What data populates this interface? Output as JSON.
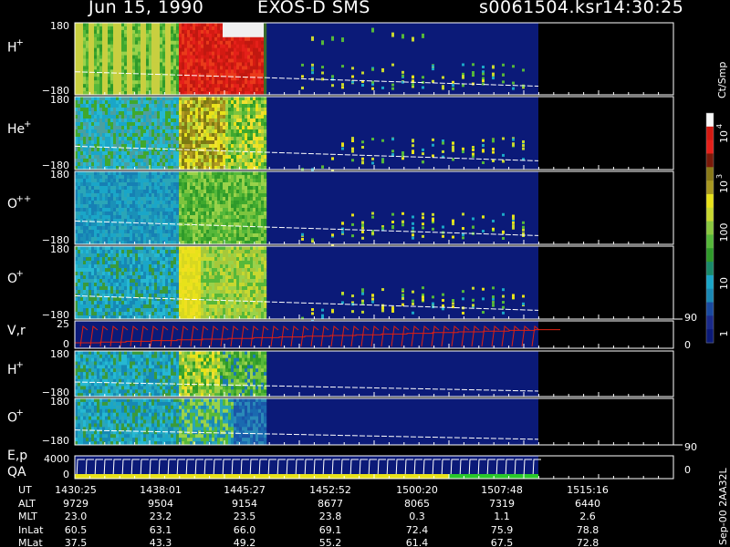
{
  "header": {
    "date": "Jun 15, 1990",
    "instrument": "EXOS-D SMS",
    "file": "s0061504.ksr",
    "time": "14:30:25"
  },
  "chart_data": {
    "type": "heatmap",
    "panels": [
      {
        "label": "H",
        "sup": "+",
        "ylim": [
          -180,
          180
        ]
      },
      {
        "label": "He",
        "sup": "+",
        "ylim": [
          -180,
          180
        ]
      },
      {
        "label": "O",
        "sup": "++",
        "ylim": [
          -180,
          180
        ]
      },
      {
        "label": "O",
        "sup": "+",
        "ylim": [
          -180,
          180
        ]
      },
      {
        "label": "V,r",
        "sup": "",
        "ylim": [
          0,
          25
        ],
        "right_ticks": [
          "90",
          "0"
        ]
      },
      {
        "label": "H",
        "sup": "+",
        "ylim": [
          -180,
          180
        ]
      },
      {
        "label": "O",
        "sup": "+",
        "ylim": [
          -180,
          180
        ]
      },
      {
        "label": "E,p",
        "label2": "QA",
        "sup": "",
        "ylim": [
          0,
          4000
        ],
        "right_ticks": [
          "90",
          "0"
        ]
      }
    ],
    "colorbar": {
      "label": "Ct/Smp",
      "tick_labels": [
        "1",
        "10",
        "100",
        "10",
        "10"
      ],
      "tick_sups": [
        "",
        "",
        "",
        "3",
        "4"
      ],
      "scale": "log",
      "range": [
        1,
        10000
      ]
    },
    "x_ticks": {
      "rows": [
        "UT",
        "ALT",
        "MLT",
        "InLat",
        "MLat"
      ],
      "columns": [
        {
          "UT": "1430:25",
          "ALT": "9729",
          "MLT": "23.0",
          "InLat": "60.5",
          "MLat": "37.5"
        },
        {
          "UT": "1438:01",
          "ALT": "9504",
          "MLT": "23.2",
          "InLat": "63.1",
          "MLat": "43.3"
        },
        {
          "UT": "1445:27",
          "ALT": "9154",
          "MLT": "23.5",
          "InLat": "66.0",
          "MLat": "49.2"
        },
        {
          "UT": "1452:52",
          "ALT": "8677",
          "MLT": "23.8",
          "InLat": "69.1",
          "MLat": "55.2"
        },
        {
          "UT": "1500:20",
          "ALT": "8065",
          "MLT": "0.3",
          "InLat": "72.4",
          "MLat": "61.4"
        },
        {
          "UT": "1507:48",
          "ALT": "7319",
          "MLT": "1.1",
          "InLat": "75.9",
          "MLat": "67.5"
        },
        {
          "UT": "1515:16",
          "ALT": "6440",
          "MLT": "2.6",
          "InLat": "78.8",
          "MLat": "72.8"
        }
      ]
    },
    "footer": "Sep-00 2AA32L",
    "grid": false
  }
}
